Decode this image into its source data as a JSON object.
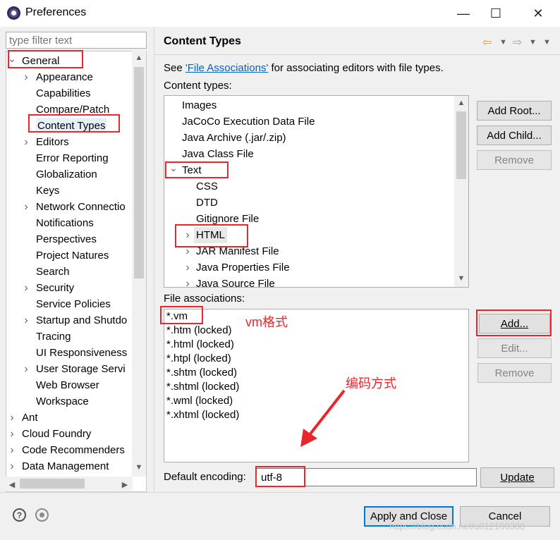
{
  "window": {
    "title": "Preferences"
  },
  "titlebar_icons": {
    "minimize": "minimize-icon",
    "maximize": "maximize-icon",
    "close": "close-icon"
  },
  "filter": {
    "placeholder": "type filter text"
  },
  "tree": {
    "general": "General",
    "children": [
      "Appearance",
      "Capabilities",
      "Compare/Patch",
      "Content Types",
      "Editors",
      "Error Reporting",
      "Globalization",
      "Keys",
      "Network Connectio",
      "Notifications",
      "Perspectives",
      "Project Natures",
      "Search",
      "Security",
      "Service Policies",
      "Startup and Shutdo",
      "Tracing",
      "UI Responsiveness",
      "User Storage Servi",
      "Web Browser",
      "Workspace"
    ],
    "top_level": [
      "Ant",
      "Cloud Foundry",
      "Code Recommenders",
      "Data Management"
    ]
  },
  "page": {
    "title": "Content Types",
    "see_prefix": "See ",
    "see_link": "'File Associations'",
    "see_suffix": " for associating editors with file types.",
    "content_types_label": "Content types:",
    "file_assoc_label": "File associations:",
    "encoding_label": "Default encoding:"
  },
  "content_types": {
    "top": [
      "Images",
      "JaCoCo Execution Data File",
      "Java Archive (.jar/.zip)",
      "Java Class File"
    ],
    "text": "Text",
    "text_children": [
      "CSS",
      "DTD",
      "Gitignore File",
      "HTML",
      "JAR Manifest File",
      "Java Properties File",
      "Java Source File"
    ]
  },
  "file_associations": [
    "*.vm",
    "*.htm (locked)",
    "*.html (locked)",
    "*.htpl (locked)",
    "*.shtm (locked)",
    "*.shtml (locked)",
    "*.wml (locked)",
    "*.xhtml (locked)"
  ],
  "buttons": {
    "add_root": "Add Root...",
    "add_child": "Add Child...",
    "remove": "Remove",
    "add": "Add...",
    "edit": "Edit...",
    "remove2": "Remove",
    "update": "Update",
    "apply_close": "Apply and Close",
    "cancel": "Cancel"
  },
  "encoding": {
    "value": "utf-8"
  },
  "annotations": {
    "vm_format": "vm格式",
    "encoding_method": "编码方式"
  },
  "watermark": "https://blog.csdn.net/u012100388",
  "colors": {
    "annotation_red": "#e8262b",
    "link_blue": "#0563c1",
    "primary_border": "#0078d7"
  }
}
